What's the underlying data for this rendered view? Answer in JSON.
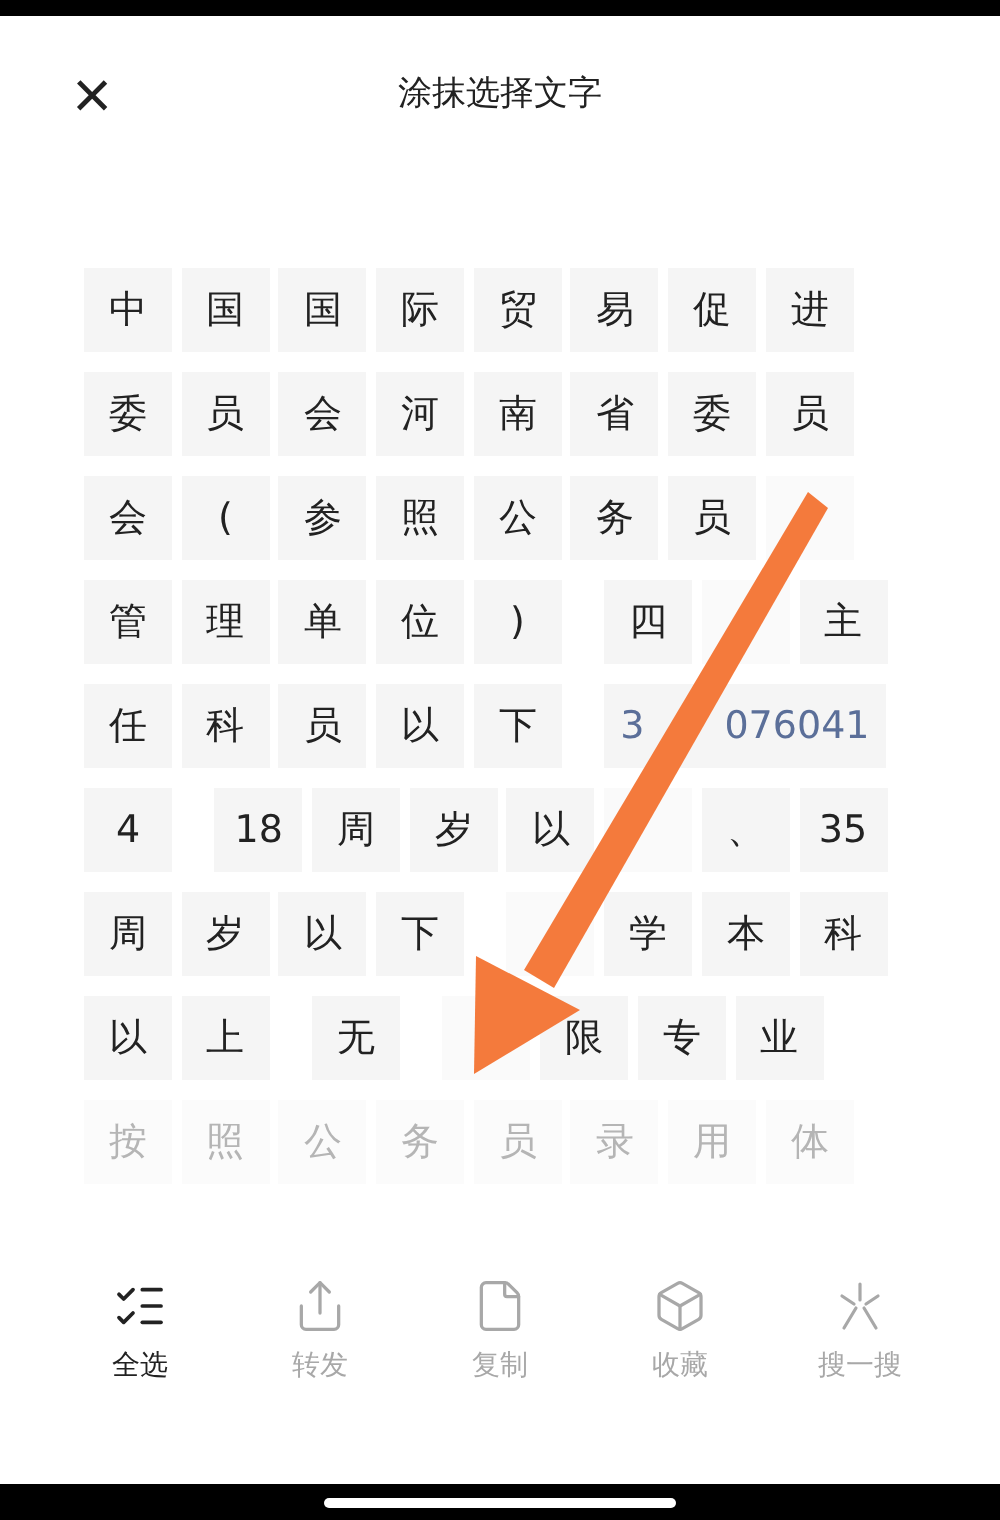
{
  "header": {
    "close": "×",
    "title": "涂抹选择文字"
  },
  "rows": [
    {
      "tokens": [
        {
          "text": "中"
        },
        {
          "text": "国"
        },
        {
          "text": "国"
        },
        {
          "text": "际"
        },
        {
          "text": "贸"
        },
        {
          "text": "易"
        },
        {
          "text": "促"
        },
        {
          "text": "进"
        }
      ]
    },
    {
      "tokens": [
        {
          "text": "委"
        },
        {
          "text": "员"
        },
        {
          "text": "会"
        },
        {
          "text": "河"
        },
        {
          "text": "南"
        },
        {
          "text": "省"
        },
        {
          "text": "委"
        },
        {
          "text": "员"
        }
      ]
    },
    {
      "tokens": [
        {
          "text": "会"
        },
        {
          "text": "("
        },
        {
          "text": "参"
        },
        {
          "text": "照"
        },
        {
          "text": "公"
        },
        {
          "text": "务"
        },
        {
          "text": "员"
        },
        {
          "kind": "blank"
        }
      ]
    },
    {
      "tokens": [
        {
          "text": "管"
        },
        {
          "text": "理"
        },
        {
          "text": "单"
        },
        {
          "text": "位"
        },
        {
          "text": ")"
        },
        {
          "kind": "space"
        },
        {
          "text": "四"
        },
        {
          "kind": "blank"
        },
        {
          "text": "主"
        }
      ]
    },
    {
      "tokens": [
        {
          "text": "任"
        },
        {
          "text": "科"
        },
        {
          "text": "员"
        },
        {
          "text": "以"
        },
        {
          "text": "下"
        },
        {
          "kind": "space"
        },
        {
          "kind": "number",
          "parts": [
            "3",
            "076041"
          ]
        }
      ]
    },
    {
      "tokens": [
        {
          "text": "4"
        },
        {
          "kind": "space"
        },
        {
          "text": "18"
        },
        {
          "text": "周"
        },
        {
          "text": "岁"
        },
        {
          "text": "以"
        },
        {
          "kind": "blank"
        },
        {
          "text": "、"
        },
        {
          "text": "35"
        }
      ]
    },
    {
      "tokens": [
        {
          "text": "周"
        },
        {
          "text": "岁"
        },
        {
          "text": "以"
        },
        {
          "text": "下"
        },
        {
          "kind": "space"
        },
        {
          "kind": "blank"
        },
        {
          "text": "学"
        },
        {
          "text": "本"
        },
        {
          "text": "科"
        }
      ]
    },
    {
      "tokens": [
        {
          "text": "以"
        },
        {
          "text": "上"
        },
        {
          "kind": "space"
        },
        {
          "text": "无"
        },
        {
          "kind": "space"
        },
        {
          "kind": "blank"
        },
        {
          "text": "限"
        },
        {
          "text": "专"
        },
        {
          "text": "业"
        }
      ]
    },
    {
      "faded": true,
      "tokens": [
        {
          "text": "按"
        },
        {
          "text": "照"
        },
        {
          "text": "公"
        },
        {
          "text": "务"
        },
        {
          "text": "员"
        },
        {
          "text": "录"
        },
        {
          "text": "用"
        },
        {
          "text": "体"
        }
      ]
    }
  ],
  "toolbar": [
    {
      "label": "全选",
      "kind": "select-all",
      "disabled": false
    },
    {
      "label": "转发",
      "kind": "share",
      "disabled": true
    },
    {
      "label": "复制",
      "kind": "copy",
      "disabled": true
    },
    {
      "label": "收藏",
      "kind": "favorite",
      "disabled": true
    },
    {
      "label": "搜一搜",
      "kind": "search",
      "disabled": true
    }
  ]
}
